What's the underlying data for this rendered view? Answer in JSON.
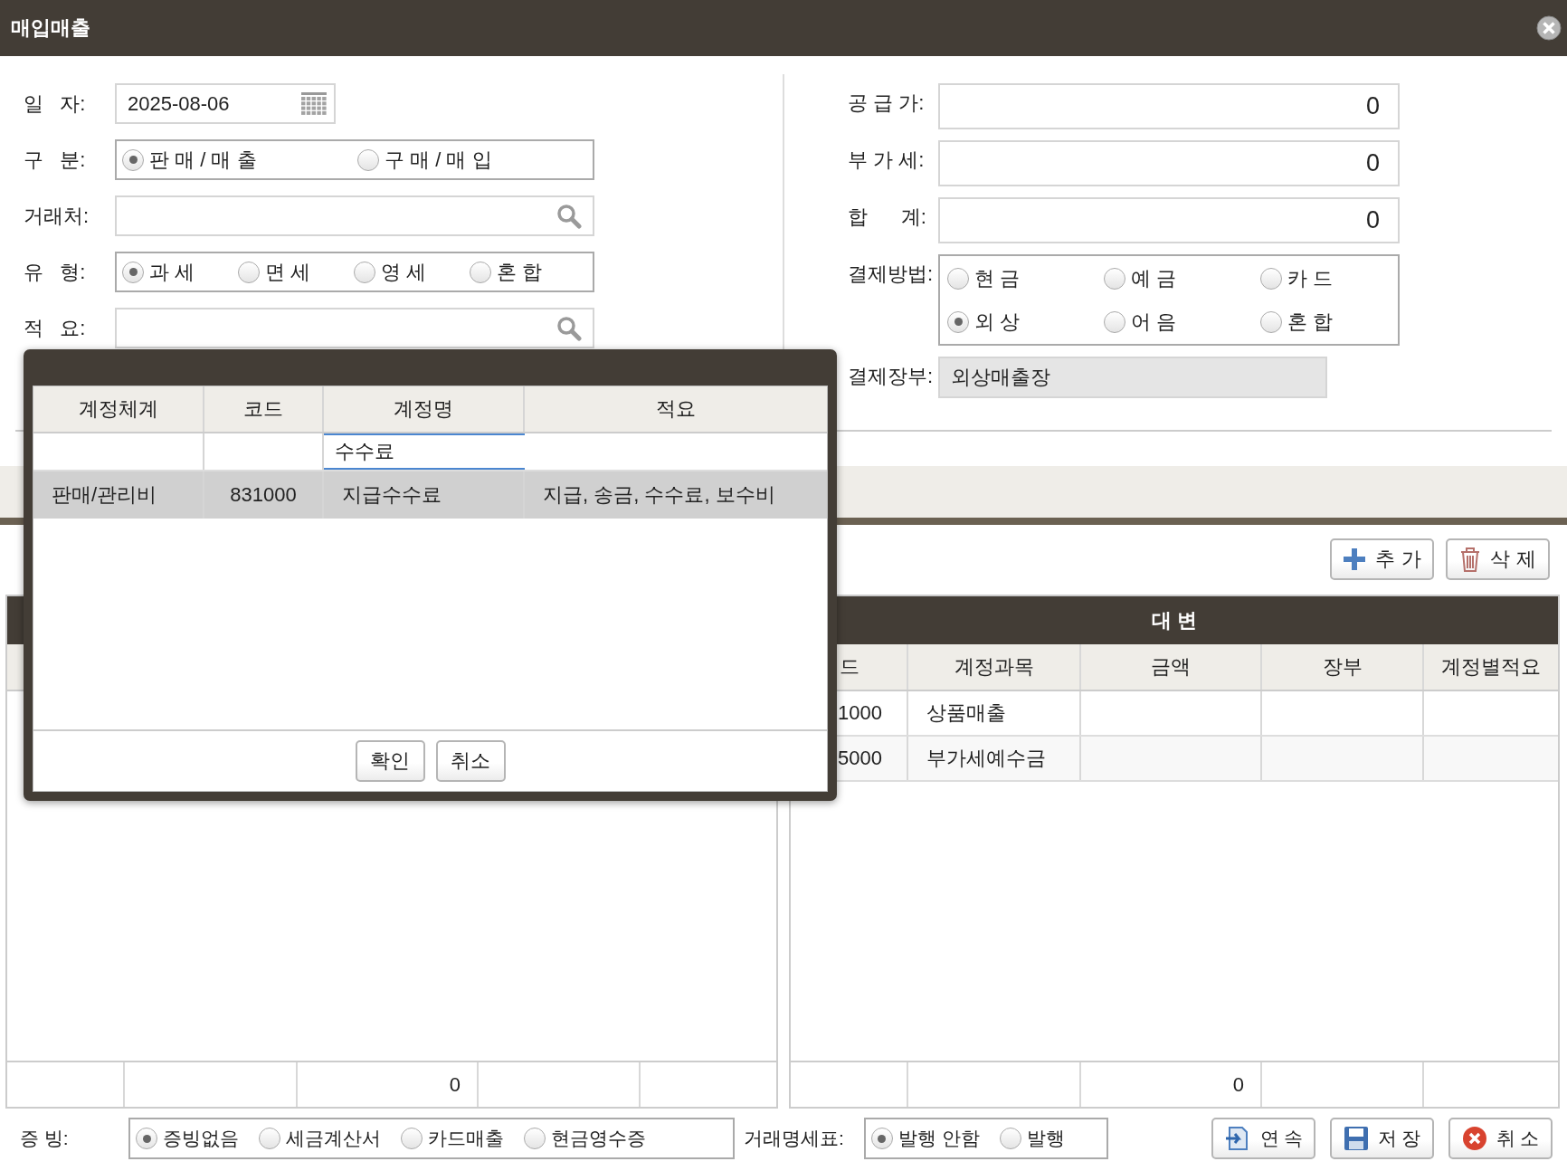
{
  "window": {
    "title": "매입매출"
  },
  "form_left": [
    {
      "kind": "date",
      "label": "일   자:",
      "value": "2025-08-06"
    },
    {
      "kind": "radio",
      "label": "구   분:",
      "options": [
        {
          "label": "판 매 / 매 출",
          "selected": true
        },
        {
          "label": "구 매 / 매 입",
          "selected": false
        }
      ]
    },
    {
      "kind": "search",
      "label": "거래처:"
    },
    {
      "kind": "radio",
      "label": "유   형:",
      "options": [
        {
          "label": "과 세",
          "selected": true
        },
        {
          "label": "면 세",
          "selected": false
        },
        {
          "label": "영 세",
          "selected": false
        },
        {
          "label": "혼 합",
          "selected": false
        }
      ]
    },
    {
      "kind": "search",
      "label": "적   요:"
    }
  ],
  "form_right": [
    {
      "kind": "number",
      "label": "공 급 가:",
      "value": "0"
    },
    {
      "kind": "number",
      "label": "부 가 세:",
      "value": "0"
    },
    {
      "kind": "number",
      "label": "합      계:",
      "value": "0"
    },
    {
      "kind": "radio_grid",
      "label": "결제방법:",
      "options": [
        {
          "label": "현 금",
          "selected": false
        },
        {
          "label": "예 금",
          "selected": false
        },
        {
          "label": "카 드",
          "selected": false
        },
        {
          "label": "외 상",
          "selected": true
        },
        {
          "label": "어 음",
          "selected": false
        },
        {
          "label": "혼 합",
          "selected": false
        }
      ]
    },
    {
      "kind": "readonly",
      "label": "결제장부:",
      "value": "외상매출장"
    }
  ],
  "toolbar": [
    {
      "label": "추 가",
      "kind": "add"
    },
    {
      "label": "삭 제",
      "kind": "delete"
    }
  ],
  "left_table": {
    "footer_total": "0"
  },
  "right_table": {
    "title": "대 변",
    "columns": [
      "드",
      "계정과목",
      "금액",
      "장부",
      "계정별적요"
    ],
    "rows": [
      {
        "code": "1000",
        "account": "상품매출"
      },
      {
        "code": "5000",
        "account": "부가세예수금"
      }
    ],
    "footer_total": "0"
  },
  "modal": {
    "columns": [
      "계정체계",
      "코드",
      "계정명",
      "적요"
    ],
    "name_filter": {
      "value": "수수료"
    },
    "rows": [
      {
        "system": "판매/관리비",
        "code": "831000",
        "name": "지급수수료",
        "summary": "지급, 송금, 수수료, 보수비",
        "selected": true
      }
    ],
    "buttons": [
      "확인",
      "취소"
    ]
  },
  "evidence": {
    "label": "증 빙:",
    "options": [
      {
        "label": "증빙없음",
        "selected": true
      },
      {
        "label": "세금계산서",
        "selected": false
      },
      {
        "label": "카드매출",
        "selected": false
      },
      {
        "label": "현금영수증",
        "selected": false
      }
    ]
  },
  "statement": {
    "label": "거래명세표:",
    "options": [
      {
        "label": "발행 안함",
        "selected": true
      },
      {
        "label": "발행",
        "selected": false
      }
    ]
  },
  "actions": [
    {
      "label": "연 속",
      "kind": "continue"
    },
    {
      "label": "저 장",
      "kind": "save"
    },
    {
      "label": "취 소",
      "kind": "cancel"
    }
  ]
}
